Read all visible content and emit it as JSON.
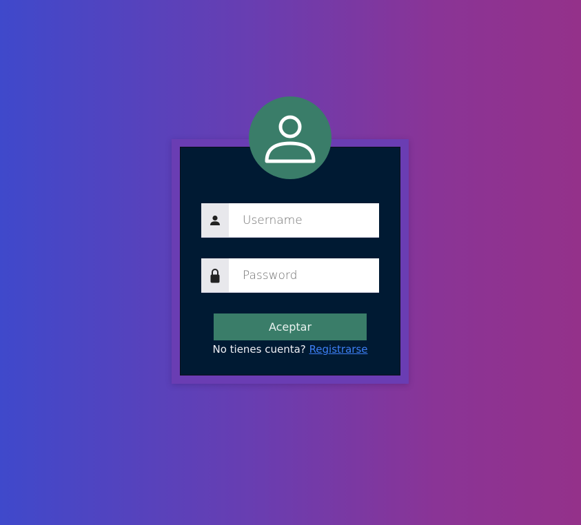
{
  "colors": {
    "background_start": "#3f49cb",
    "background_end": "#94318a",
    "frame": "#6a3db3",
    "panel": "#001a33",
    "accent": "#3a7d69",
    "link": "#3d7ff5"
  },
  "avatar": {
    "icon": "user-outline-icon"
  },
  "login": {
    "username": {
      "icon": "user-icon",
      "value": "",
      "placeholder": "Username"
    },
    "password": {
      "icon": "lock-icon",
      "value": "",
      "placeholder": "Password"
    },
    "submit_label": "Aceptar",
    "signup_prompt": "No tienes cuenta?",
    "signup_link": "Registrarse"
  }
}
